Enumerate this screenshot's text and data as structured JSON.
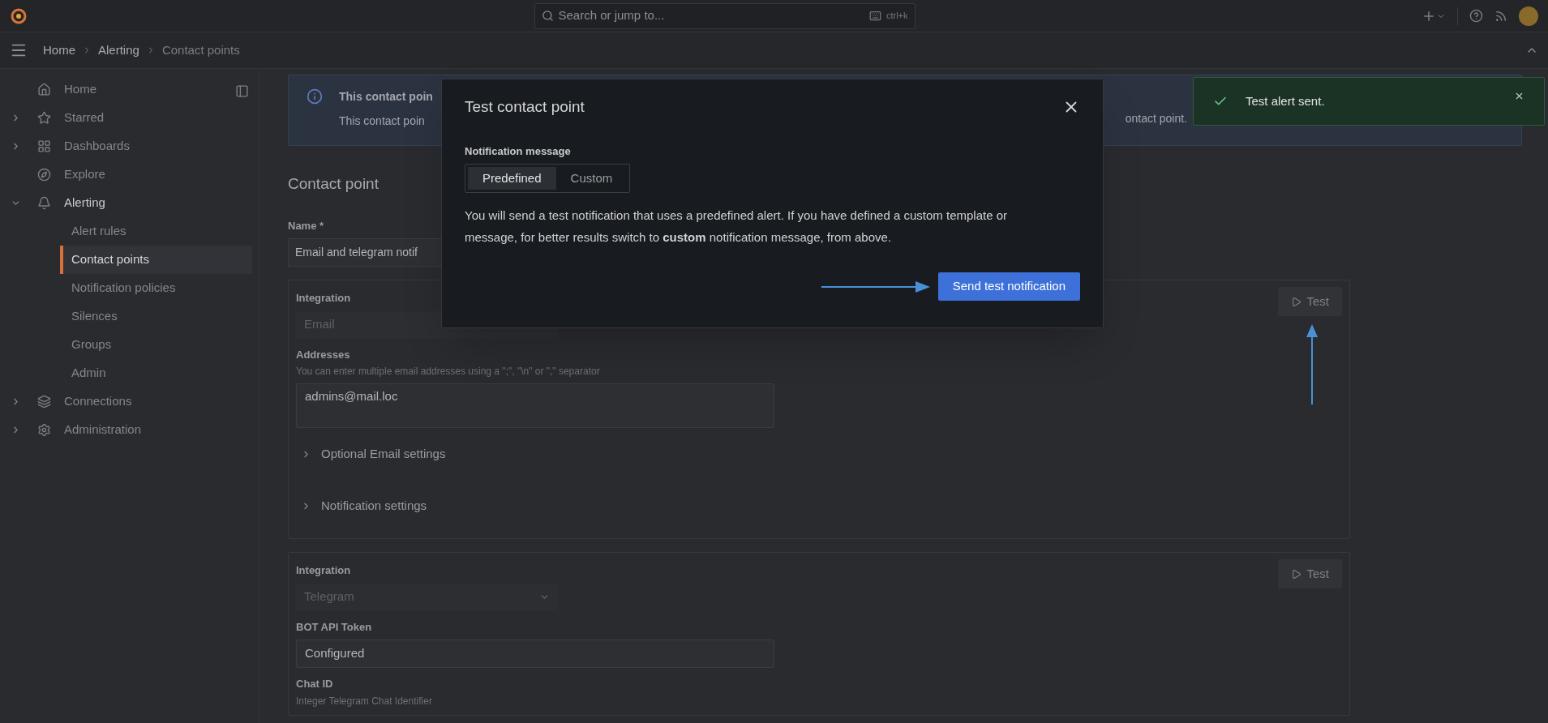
{
  "topbar": {
    "search_placeholder": "Search or jump to...",
    "shortcut": "ctrl+k"
  },
  "breadcrumbs": [
    "Home",
    "Alerting",
    "Contact points"
  ],
  "sidebar": {
    "items": [
      {
        "label": "Home",
        "kind": "link"
      },
      {
        "label": "Starred",
        "kind": "group",
        "expanded": false
      },
      {
        "label": "Dashboards",
        "kind": "group",
        "expanded": false
      },
      {
        "label": "Explore",
        "kind": "link"
      },
      {
        "label": "Alerting",
        "kind": "group",
        "expanded": true,
        "children": [
          {
            "label": "Alert rules",
            "selected": false
          },
          {
            "label": "Contact points",
            "selected": true
          },
          {
            "label": "Notification policies",
            "selected": false
          },
          {
            "label": "Silences",
            "selected": false
          },
          {
            "label": "Groups",
            "selected": false
          },
          {
            "label": "Admin",
            "selected": false
          }
        ]
      },
      {
        "label": "Connections",
        "kind": "group",
        "expanded": false
      },
      {
        "label": "Administration",
        "kind": "group",
        "expanded": false
      }
    ]
  },
  "banner": {
    "title": "This contact poin",
    "body": "This contact poin",
    "body_end": "ontact point."
  },
  "form": {
    "heading": "Contact point",
    "name_label": "Name *",
    "name_value": "Email and telegram notif",
    "integrations": [
      {
        "label": "Integration",
        "value": "Email",
        "disabled": true,
        "test_button": "Test",
        "fields": [
          {
            "kind": "textarea",
            "label": "Addresses",
            "hint": "You can enter multiple email addresses using a \";\", \"\\n\" or \",\" separator",
            "value": "admins@mail.loc"
          },
          {
            "kind": "collapsible",
            "label": "Optional Email settings",
            "expanded": false
          },
          {
            "kind": "collapsible",
            "label": "Notification settings",
            "expanded": false
          }
        ]
      },
      {
        "label": "Integration",
        "value": "Telegram",
        "disabled": true,
        "test_button": "Test",
        "fields": [
          {
            "kind": "input",
            "label": "BOT API Token",
            "value": "Configured"
          },
          {
            "kind": "label",
            "label": "Chat ID",
            "hint": "Integer Telegram Chat Identifier"
          }
        ]
      }
    ]
  },
  "modal": {
    "title": "Test contact point",
    "message_label": "Notification message",
    "segments": [
      {
        "label": "Predefined",
        "selected": true
      },
      {
        "label": "Custom",
        "selected": false
      }
    ],
    "description": "You will send a test notification that uses a predefined alert. If you have defined a custom template or message, for better results switch to **custom** notification message, from above.",
    "button": "Send test notification"
  },
  "toast": {
    "message": "Test alert sent."
  }
}
